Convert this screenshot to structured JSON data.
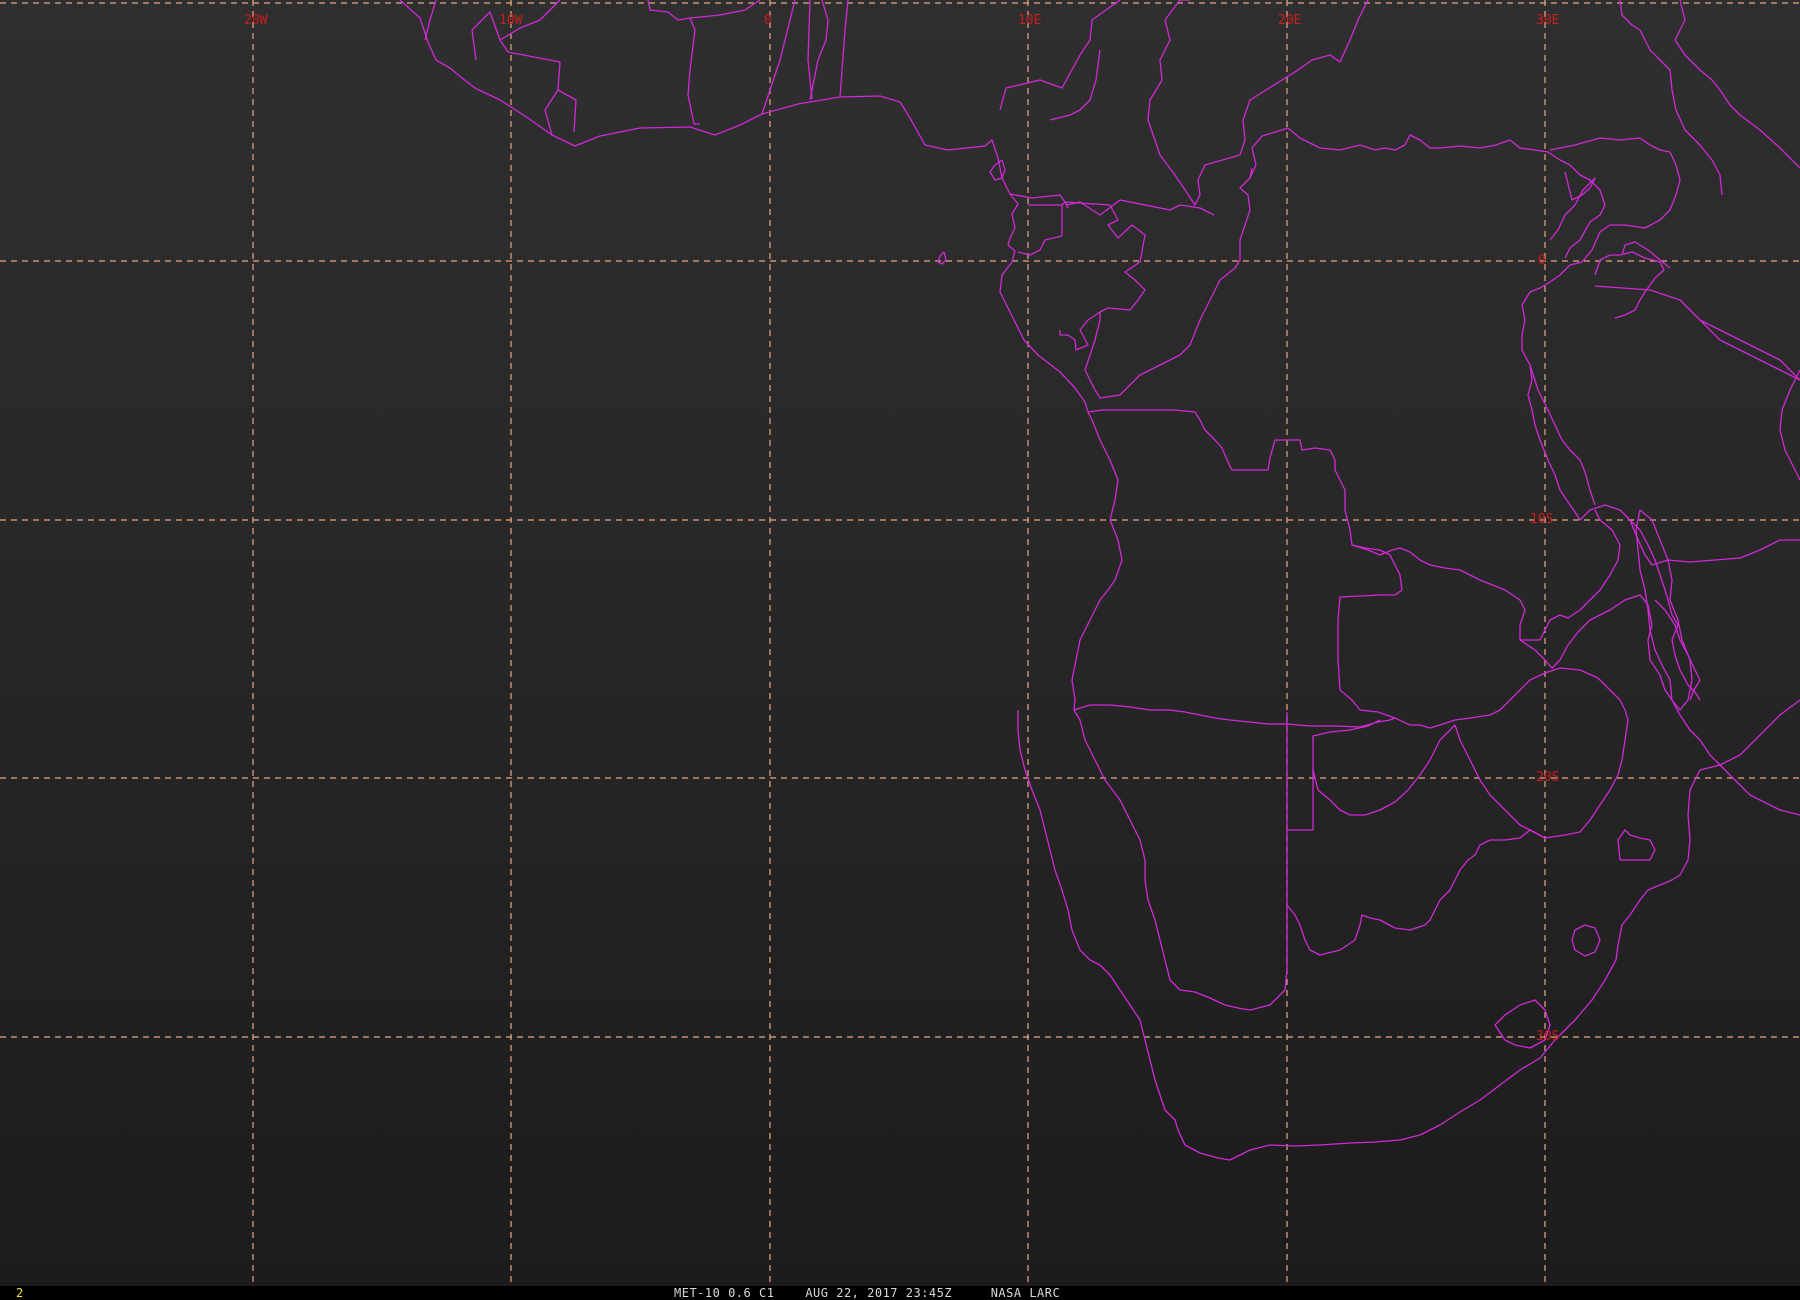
{
  "map": {
    "longitude_labels": [
      "20W",
      "10W",
      "0",
      "10E",
      "20E",
      "30E"
    ],
    "latitude_labels": [
      "0",
      "10S",
      "20S",
      "30S"
    ],
    "colors": {
      "background": "#2a2a2a",
      "graticule": "#e8a882",
      "graticule_label": "#c81e1e",
      "political_boundaries": "#d228d8"
    },
    "coverage": "West, Central and Southern Africa with the South Atlantic Ocean"
  },
  "status_bar": {
    "frame_number": "2",
    "caption": "MET-10 0.6 C1    AUG 22, 2017 23:45Z     NASA LARC"
  }
}
